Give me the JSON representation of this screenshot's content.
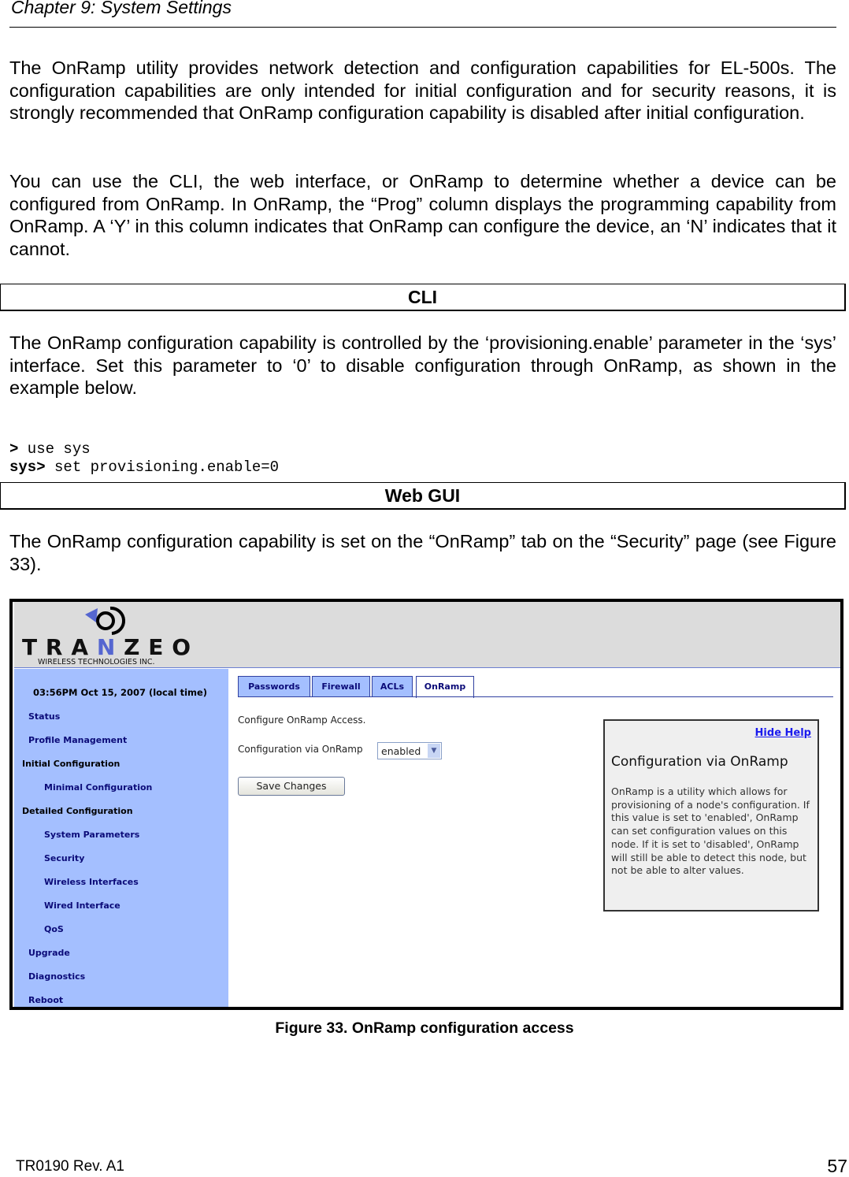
{
  "header": {
    "chapter": "Chapter 9: System Settings"
  },
  "paragraphs": [
    "The OnRamp utility provides network detection and configuration capabilities for EL-500s. The configuration capabilities are only intended for initial configuration and for security reasons, it is strongly recommended that OnRamp configuration capability is disabled after initial configuration.",
    "You can use the CLI, the web interface, or OnRamp to determine whether a device can be configured from OnRamp. In OnRamp, the “Prog” column displays the programming capability from OnRamp. A ‘Y’ in this column indicates that OnRamp can configure the device, an ‘N’ indicates that it cannot."
  ],
  "cli": {
    "heading": "CLI",
    "text": "The OnRamp configuration capability is controlled by the ‘provisioning.enable’ parameter in the ‘sys’ interface. Set this parameter to ‘0’ to disable configuration through OnRamp, as shown in the example below.",
    "code": [
      {
        "prompt": ">",
        "cmd": " use sys"
      },
      {
        "prompt": "sys>",
        "cmd": " set provisioning.enable=0"
      }
    ]
  },
  "webgui": {
    "heading": "Web GUI",
    "text": "The OnRamp configuration capability is set on the “OnRamp” tab on the “Security” page (see Figure 33)."
  },
  "screenshot": {
    "logo": {
      "brand": "TRANZEO",
      "tagline": "WIRELESS TECHNOLOGIES INC."
    },
    "time": "03:56PM Oct 15, 2007 (local time)",
    "sidebar": [
      {
        "label": "Status",
        "level": 1
      },
      {
        "label": "Profile Management",
        "level": 1
      },
      {
        "label": "Initial Configuration",
        "level": 0
      },
      {
        "label": "Minimal Configuration",
        "level": 2
      },
      {
        "label": "Detailed Configuration",
        "level": 0
      },
      {
        "label": "System Parameters",
        "level": 2
      },
      {
        "label": "Security",
        "level": 2
      },
      {
        "label": "Wireless Interfaces",
        "level": 2
      },
      {
        "label": "Wired Interface",
        "level": 2
      },
      {
        "label": "QoS",
        "level": 2
      },
      {
        "label": "Upgrade",
        "level": 1
      },
      {
        "label": "Diagnostics",
        "level": 1
      },
      {
        "label": "Reboot",
        "level": 1
      }
    ],
    "tabs": [
      {
        "label": "Passwords"
      },
      {
        "label": "Firewall"
      },
      {
        "label": "ACLs"
      },
      {
        "label": "OnRamp",
        "active": true
      }
    ],
    "intro": "Configure OnRamp Access.",
    "field_label": "Configuration via OnRamp",
    "field_value": "enabled",
    "save_label": "Save Changes",
    "help": {
      "link": "Hide Help",
      "title": "Configuration via OnRamp",
      "body": "OnRamp is a utility which allows for provisioning of a node's configuration. If this value is set to 'enabled', OnRamp can set configuration values on this node. If it is set to 'disabled', OnRamp will still be able to detect this node, but not be able to alter values."
    },
    "colors": {
      "sidebar": "#a4bfff",
      "link": "#0b0b78",
      "header": "#dcdcdc"
    }
  },
  "caption": "Figure 33. OnRamp configuration access",
  "footer": {
    "doc": "TR0190 Rev. A1",
    "page": "57"
  }
}
